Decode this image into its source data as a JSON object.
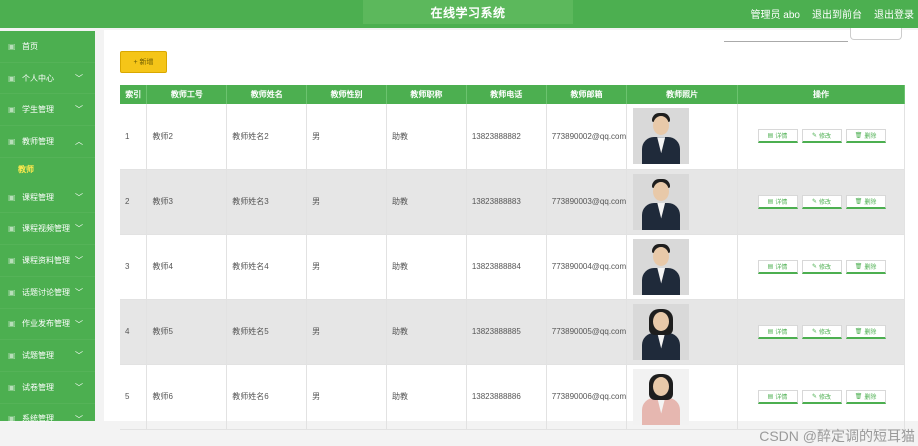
{
  "header": {
    "title": "在线学习系统",
    "user": "管理员 abo",
    "back_label": "退出到前台",
    "logout_label": "退出登录"
  },
  "sidebar": {
    "items": [
      {
        "label": "首页",
        "chevron": false
      },
      {
        "label": "个人中心",
        "chevron": true
      },
      {
        "label": "学生管理",
        "chevron": true
      },
      {
        "label": "教师管理",
        "chevron": true,
        "expanded": true
      },
      {
        "label": "课程管理",
        "chevron": true
      },
      {
        "label": "课程视频管理",
        "chevron": true
      },
      {
        "label": "课程资料管理",
        "chevron": true
      },
      {
        "label": "话题讨论管理",
        "chevron": true
      },
      {
        "label": "作业发布管理",
        "chevron": true
      },
      {
        "label": "试题管理",
        "chevron": true
      },
      {
        "label": "试卷管理",
        "chevron": true
      },
      {
        "label": "系统管理",
        "chevron": true
      }
    ],
    "sub_item": "教师"
  },
  "toolbar": {
    "add_label": "新增"
  },
  "table": {
    "headers": [
      "索引",
      "教师工号",
      "教师姓名",
      "教师性别",
      "教师职称",
      "教师电话",
      "教师邮箱",
      "教师照片",
      "操作"
    ],
    "rows": [
      {
        "index": "1",
        "id": "教师2",
        "name": "教师姓名2",
        "gender": "男",
        "title": "助教",
        "phone": "13823888882",
        "email": "773890002@qq.com",
        "photo": "male"
      },
      {
        "index": "2",
        "id": "教师3",
        "name": "教师姓名3",
        "gender": "男",
        "title": "助教",
        "phone": "13823888883",
        "email": "773890003@qq.com",
        "photo": "male"
      },
      {
        "index": "3",
        "id": "教师4",
        "name": "教师姓名4",
        "gender": "男",
        "title": "助教",
        "phone": "13823888884",
        "email": "773890004@qq.com",
        "photo": "male"
      },
      {
        "index": "4",
        "id": "教师5",
        "name": "教师姓名5",
        "gender": "男",
        "title": "助教",
        "phone": "13823888885",
        "email": "773890005@qq.com",
        "photo": "female"
      },
      {
        "index": "5",
        "id": "教师6",
        "name": "教师姓名6",
        "gender": "男",
        "title": "助教",
        "phone": "13823888886",
        "email": "773890006@qq.com",
        "photo": "female-light"
      }
    ],
    "actions": {
      "detail": "详情",
      "edit": "修改",
      "delete": "删除"
    }
  },
  "watermark": "CSDN @醉定调的短耳猫",
  "colors": {
    "primary": "#4caf50",
    "accent": "#f5c518",
    "active_sub": "#ffe94d"
  }
}
